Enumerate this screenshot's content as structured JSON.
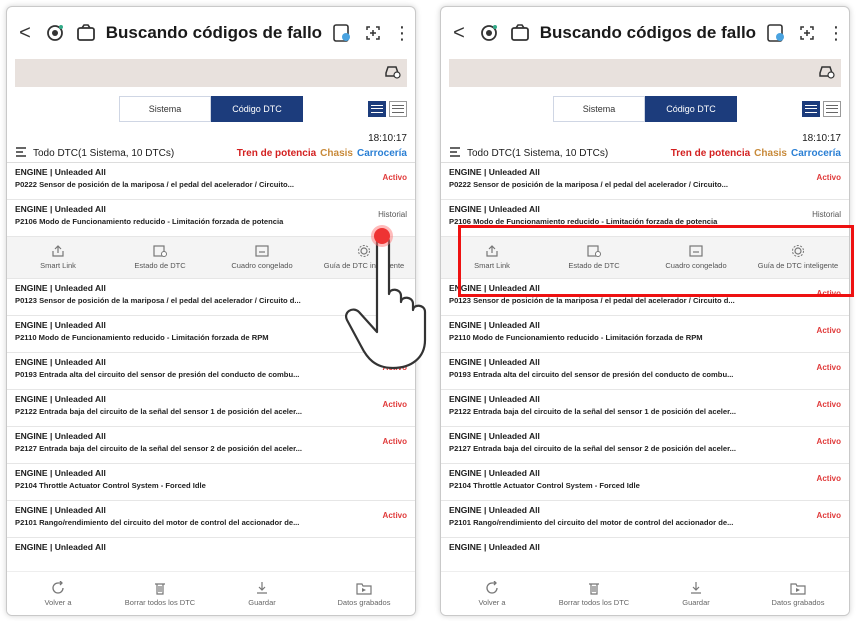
{
  "header": {
    "title": "Buscando códigos de fallo",
    "back": "<",
    "more": "⋮"
  },
  "tabs": [
    "Sistema",
    "Código DTC"
  ],
  "time": "18:10:17",
  "summary": {
    "label": "Todo DTC(1 Sistema, 10 DTCs)",
    "cat1": "Tren de potencia",
    "cat2": "Chasis",
    "cat3": "Carrocería"
  },
  "rows": [
    {
      "head": "ENGINE | Unleaded All",
      "desc": "P0222 Sensor de posición de la mariposa / el pedal del acelerador / Circuito...",
      "status": "Activo"
    },
    {
      "head": "ENGINE | Unleaded All",
      "desc": "P2106 Modo de Funcionamiento reducido - Limitación forzada de potencia",
      "status": "Historial"
    },
    {
      "head": "ENGINE | Unleaded All",
      "desc": "P0123 Sensor de posición de la mariposa / el pedal del acelerador / Circuito d...",
      "status": "Activo"
    },
    {
      "head": "ENGINE | Unleaded All",
      "desc": "P2110 Modo de Funcionamiento reducido - Limitación forzada de RPM",
      "status": "Activo"
    },
    {
      "head": "ENGINE | Unleaded All",
      "desc": "P0193 Entrada alta del circuito del sensor de presión del conducto de combu...",
      "status": "Activo"
    },
    {
      "head": "ENGINE | Unleaded All",
      "desc": "P2122 Entrada baja del circuito de la señal del sensor 1 de posición del aceler...",
      "status": "Activo"
    },
    {
      "head": "ENGINE | Unleaded All",
      "desc": "P2127 Entrada baja del circuito de la señal del sensor 2 de posición del aceler...",
      "status": "Activo"
    },
    {
      "head": "ENGINE | Unleaded All",
      "desc": "P2104 Throttle Actuator Control System - Forced Idle",
      "status": "Activo"
    },
    {
      "head": "ENGINE | Unleaded All",
      "desc": "P2101 Rango/rendimiento del circuito del motor de control del accionador de...",
      "status": "Activo"
    },
    {
      "head": "ENGINE | Unleaded All",
      "desc": "",
      "status": ""
    }
  ],
  "actions": [
    "Smart Link",
    "Estado de DTC",
    "Cuadro congelado",
    "Guía de DTC inteligente"
  ],
  "bottom": [
    "Volver a",
    "Borrar todos los DTC",
    "Guardar",
    "Datos grabados"
  ],
  "colors": {
    "accent": "#1c3c7c",
    "active": "#e03a3a",
    "band": "#e8e1dd",
    "highlight": "#e11111"
  }
}
